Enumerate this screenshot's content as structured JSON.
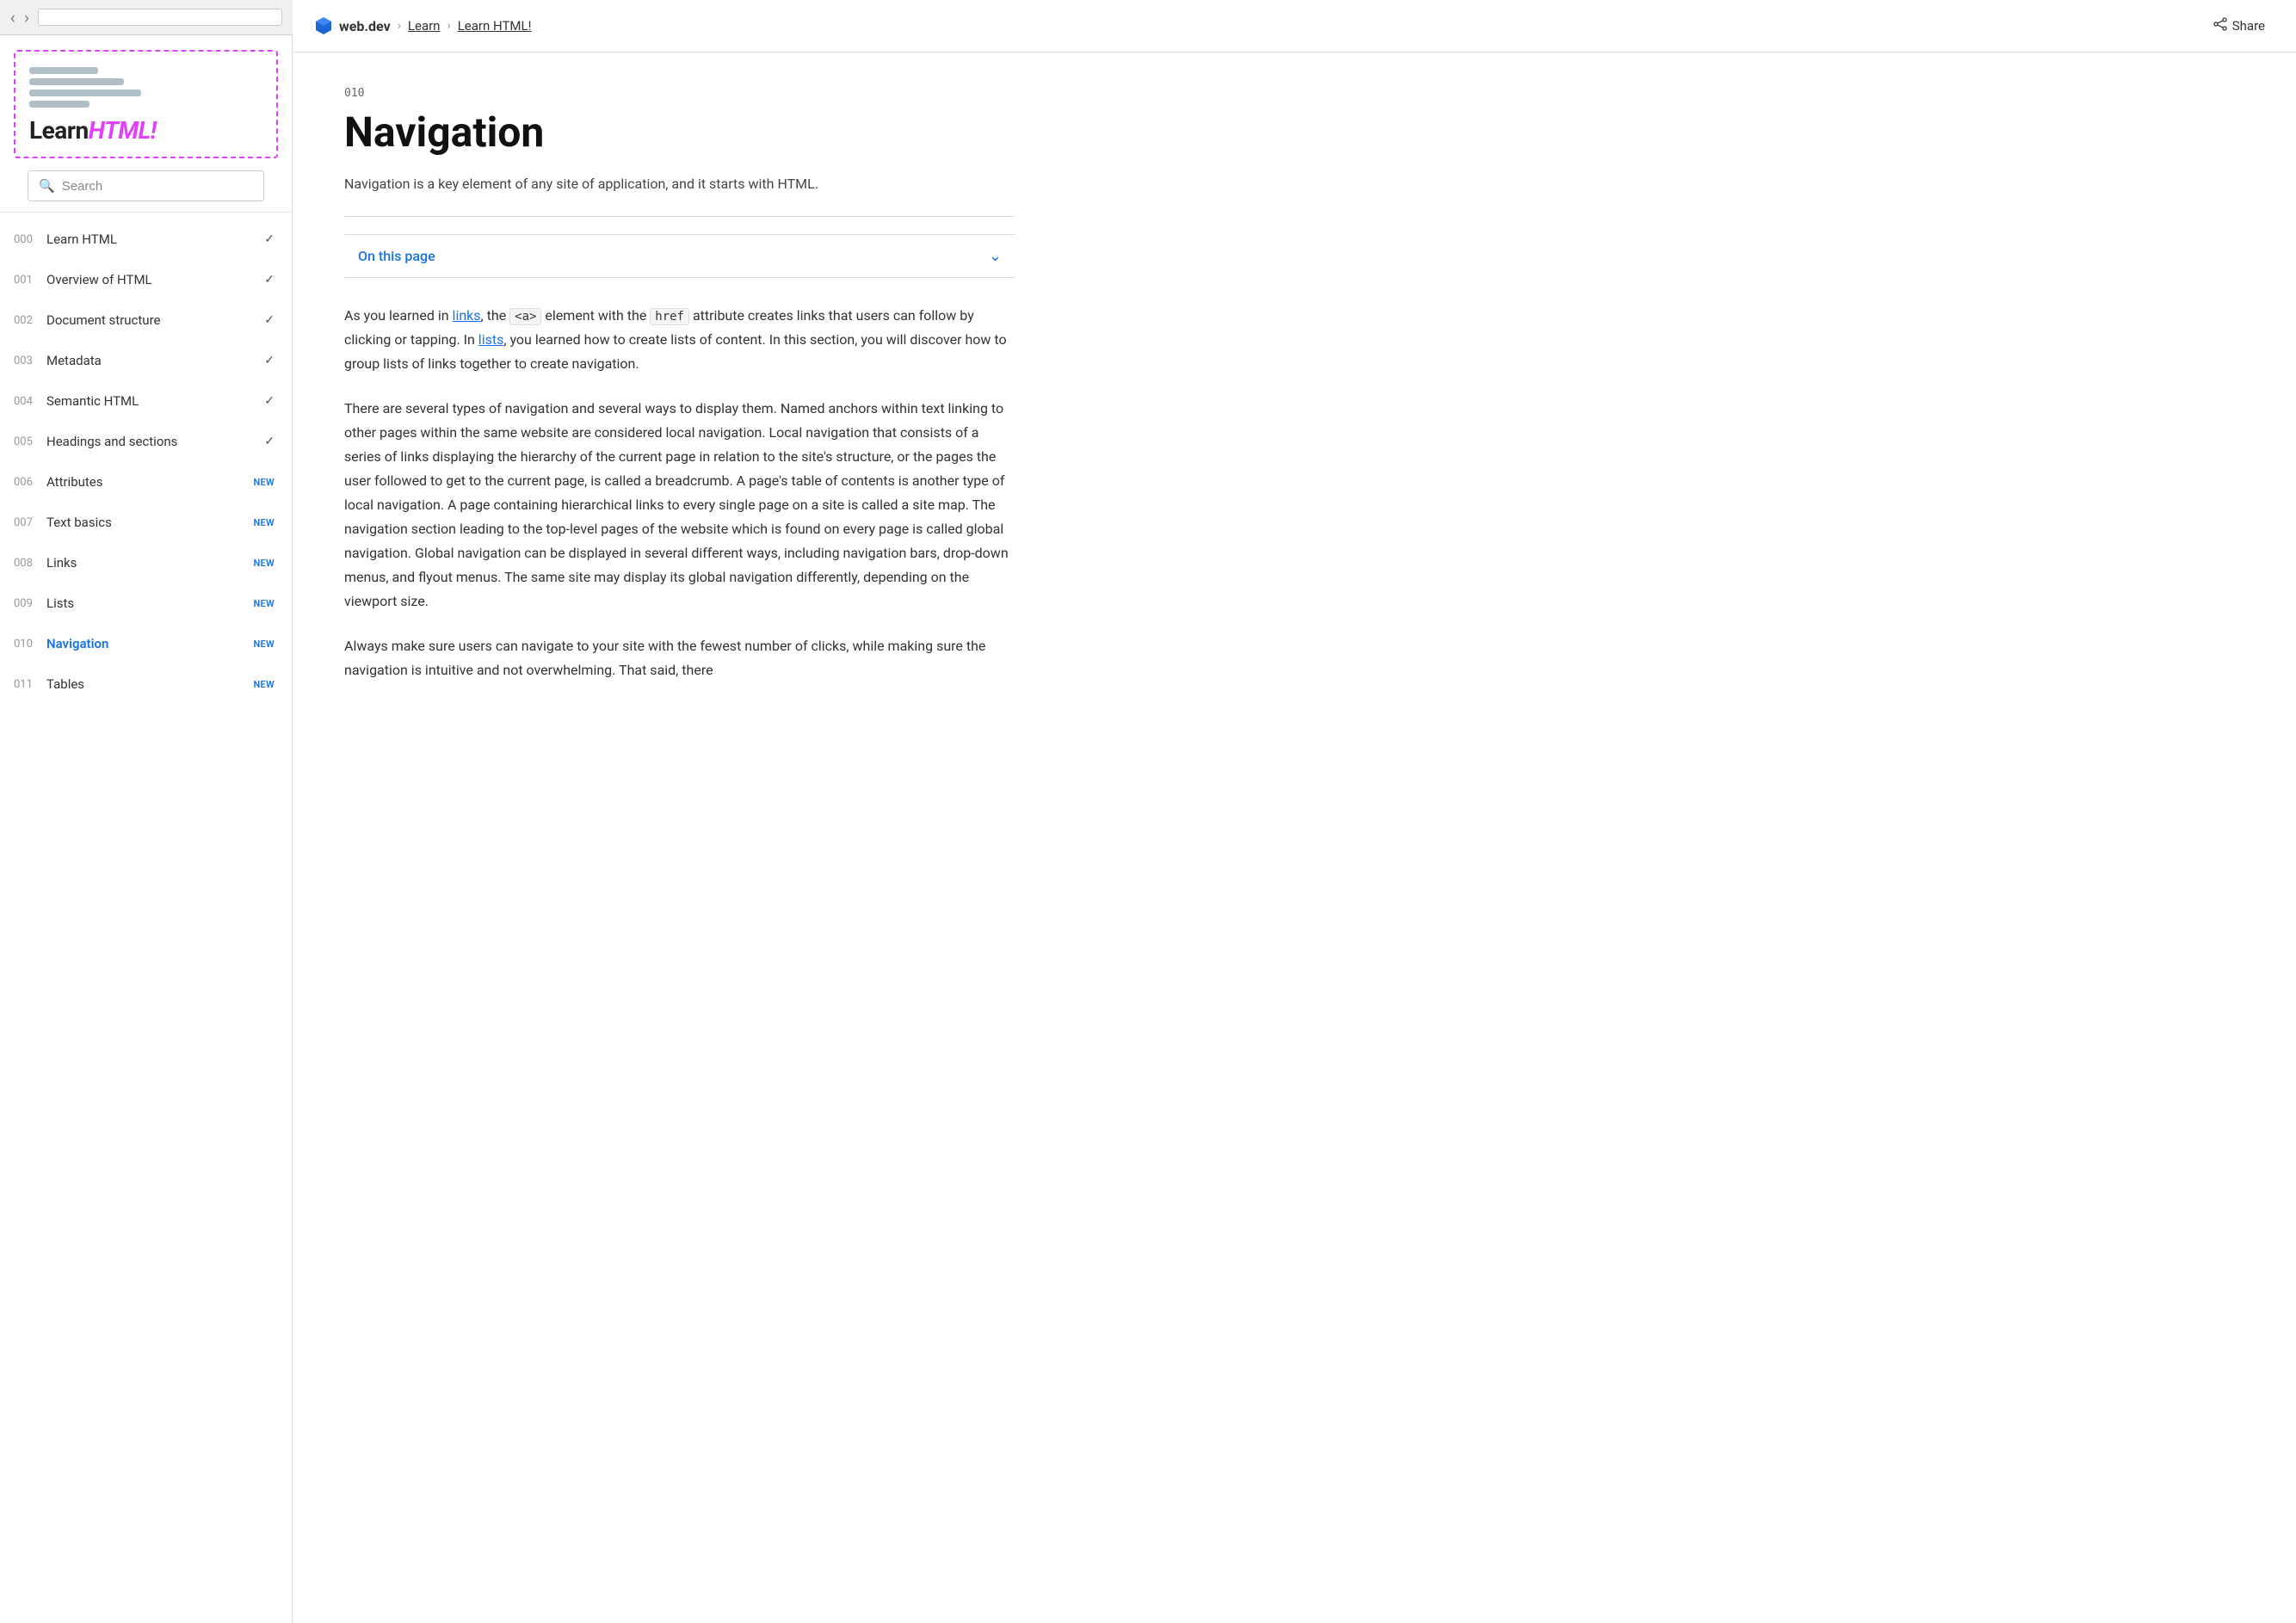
{
  "browser": {
    "back_icon": "‹",
    "forward_icon": "›"
  },
  "sidebar": {
    "logo": {
      "learn_part": "Learn",
      "html_part": "HTML!"
    },
    "search_placeholder": "Search",
    "nav_items": [
      {
        "num": "000",
        "label": "Learn HTML",
        "badge": "check",
        "active": false
      },
      {
        "num": "001",
        "label": "Overview of HTML",
        "badge": "check",
        "active": false
      },
      {
        "num": "002",
        "label": "Document structure",
        "badge": "check",
        "active": false
      },
      {
        "num": "003",
        "label": "Metadata",
        "badge": "check",
        "active": false
      },
      {
        "num": "004",
        "label": "Semantic HTML",
        "badge": "check",
        "active": false
      },
      {
        "num": "005",
        "label": "Headings and sections",
        "badge": "check",
        "active": false
      },
      {
        "num": "006",
        "label": "Attributes",
        "badge": "NEW",
        "active": false
      },
      {
        "num": "007",
        "label": "Text basics",
        "badge": "NEW",
        "active": false
      },
      {
        "num": "008",
        "label": "Links",
        "badge": "NEW",
        "active": false
      },
      {
        "num": "009",
        "label": "Lists",
        "badge": "NEW",
        "active": false
      },
      {
        "num": "010",
        "label": "Navigation",
        "badge": "NEW",
        "active": true
      },
      {
        "num": "011",
        "label": "Tables",
        "badge": "NEW",
        "active": false
      }
    ]
  },
  "topbar": {
    "site_name": "web.dev",
    "breadcrumb_learn": "Learn",
    "breadcrumb_current": "Learn HTML!",
    "share_label": "Share"
  },
  "content": {
    "lesson_num": "010",
    "title": "Navigation",
    "subtitle": "Navigation is a key element of any site of application, and it starts with HTML.",
    "on_this_page": "On this page",
    "paragraphs": [
      "As you learned in links, the <a> element with the href attribute creates links that users can follow by clicking or tapping. In lists, you learned how to create lists of content. In this section, you will discover how to group lists of links together to create navigation.",
      "There are several types of navigation and several ways to display them. Named anchors within text linking to other pages within the same website are considered local navigation. Local navigation that consists of a series of links displaying the hierarchy of the current page in relation to the site's structure, or the pages the user followed to get to the current page, is called a breadcrumb. A page's table of contents is another type of local navigation. A page containing hierarchical links to every single page on a site is called a site map. The navigation section leading to the top-level pages of the website which is found on every page is called global navigation. Global navigation can be displayed in several different ways, including navigation bars, drop-down menus, and flyout menus. The same site may display its global navigation differently, depending on the viewport size.",
      "Always make sure users can navigate to your site with the fewest number of clicks, while making sure the navigation is intuitive and not overwhelming. That said, there"
    ]
  },
  "icons": {
    "share": "⬆",
    "chevron_down": "⌄",
    "check": "✓"
  }
}
